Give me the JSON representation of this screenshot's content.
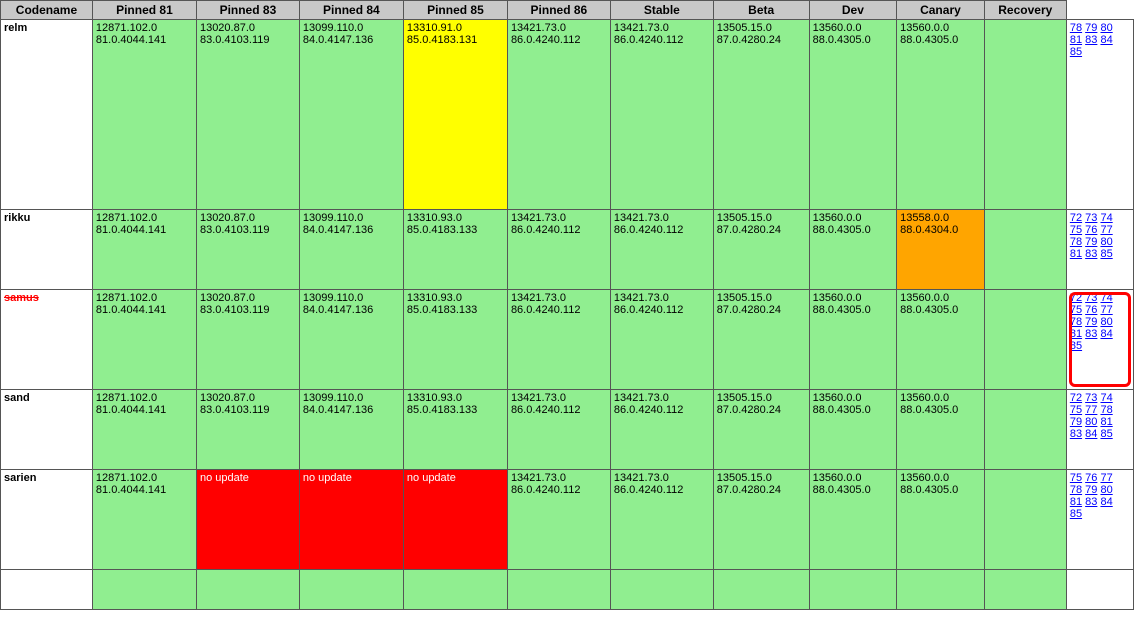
{
  "headers": [
    "Codename",
    "Pinned 81",
    "Pinned 83",
    "Pinned 84",
    "Pinned 85",
    "Pinned 86",
    "Stable",
    "Beta",
    "Dev",
    "Canary",
    "Recovery"
  ],
  "rows": [
    {
      "name": "relm",
      "nameClass": "",
      "cells": [
        {
          "text": "12871.102.0\n81.0.4044.141",
          "class": "cell-green"
        },
        {
          "text": "13020.87.0\n83.0.4103.119",
          "class": "cell-green"
        },
        {
          "text": "13099.110.0\n84.0.4147.136",
          "class": "cell-green"
        },
        {
          "text": "13310.91.0\n85.0.4183.131",
          "class": "cell-yellow"
        },
        {
          "text": "13421.73.0\n86.0.4240.112",
          "class": "cell-green"
        },
        {
          "text": "13421.73.0\n86.0.4240.112",
          "class": "cell-green"
        },
        {
          "text": "13505.15.0\n87.0.4280.24",
          "class": "cell-green"
        },
        {
          "text": "13560.0.0\n88.0.4305.0",
          "class": "cell-green"
        },
        {
          "text": "13560.0.0\n88.0.4305.0",
          "class": "cell-green"
        },
        {
          "text": "",
          "class": "cell-green"
        }
      ],
      "recovery": [
        "78",
        "79",
        "80",
        "81",
        "83",
        "84",
        "85"
      ],
      "recoveryExtraRows": true
    },
    {
      "name": "rikku",
      "nameClass": "",
      "cells": [
        {
          "text": "12871.102.0\n81.0.4044.141",
          "class": "cell-green"
        },
        {
          "text": "13020.87.0\n83.0.4103.119",
          "class": "cell-green"
        },
        {
          "text": "13099.110.0\n84.0.4147.136",
          "class": "cell-green"
        },
        {
          "text": "13310.93.0\n85.0.4183.133",
          "class": "cell-green"
        },
        {
          "text": "13421.73.0\n86.0.4240.112",
          "class": "cell-green"
        },
        {
          "text": "13421.73.0\n86.0.4240.112",
          "class": "cell-green"
        },
        {
          "text": "13505.15.0\n87.0.4280.24",
          "class": "cell-green"
        },
        {
          "text": "13560.0.0\n88.0.4305.0",
          "class": "cell-green"
        },
        {
          "text": "13558.0.0\n88.0.4304.0",
          "class": "cell-orange"
        },
        {
          "text": "",
          "class": "cell-green"
        }
      ],
      "recovery": [
        "72",
        "73",
        "74",
        "75",
        "76",
        "77",
        "78",
        "79",
        "80",
        "81",
        "83",
        "85"
      ],
      "recoveryRows": [
        [
          "72",
          "73",
          "74"
        ],
        [
          "75",
          "76",
          "77"
        ],
        [
          "78",
          "79",
          "80"
        ],
        [
          "81",
          "83",
          "85"
        ]
      ]
    },
    {
      "name": "samus",
      "nameClass": "codename-samus",
      "cells": [
        {
          "text": "12871.102.0\n81.0.4044.141",
          "class": "cell-green"
        },
        {
          "text": "13020.87.0\n83.0.4103.119",
          "class": "cell-green"
        },
        {
          "text": "13099.110.0\n84.0.4147.136",
          "class": "cell-green"
        },
        {
          "text": "13310.93.0\n85.0.4183.133",
          "class": "cell-green"
        },
        {
          "text": "13421.73.0\n86.0.4240.112",
          "class": "cell-green"
        },
        {
          "text": "13421.73.0\n86.0.4240.112",
          "class": "cell-green"
        },
        {
          "text": "13505.15.0\n87.0.4280.24",
          "class": "cell-green"
        },
        {
          "text": "13560.0.0\n88.0.4305.0",
          "class": "cell-green"
        },
        {
          "text": "13560.0.0\n88.0.4305.0",
          "class": "cell-green"
        },
        {
          "text": "",
          "class": "cell-green"
        }
      ],
      "recovery": [
        "72",
        "73",
        "74",
        "75",
        "76",
        "77",
        "78",
        "79",
        "80",
        "81",
        "83",
        "84",
        "85"
      ],
      "recoveryRows": [
        [
          "72",
          "73",
          "74"
        ],
        [
          "75",
          "76",
          "77"
        ],
        [
          "78",
          "79",
          "80"
        ],
        [
          "81",
          "83",
          "84"
        ],
        [
          "85"
        ]
      ],
      "redCircle": true
    },
    {
      "name": "sand",
      "nameClass": "",
      "cells": [
        {
          "text": "12871.102.0\n81.0.4044.141",
          "class": "cell-green"
        },
        {
          "text": "13020.87.0\n83.0.4103.119",
          "class": "cell-green"
        },
        {
          "text": "13099.110.0\n84.0.4147.136",
          "class": "cell-green"
        },
        {
          "text": "13310.93.0\n85.0.4183.133",
          "class": "cell-green"
        },
        {
          "text": "13421.73.0\n86.0.4240.112",
          "class": "cell-green"
        },
        {
          "text": "13421.73.0\n86.0.4240.112",
          "class": "cell-green"
        },
        {
          "text": "13505.15.0\n87.0.4280.24",
          "class": "cell-green"
        },
        {
          "text": "13560.0.0\n88.0.4305.0",
          "class": "cell-green"
        },
        {
          "text": "13560.0.0\n88.0.4305.0",
          "class": "cell-green"
        },
        {
          "text": "",
          "class": "cell-green"
        }
      ],
      "recovery": [
        "72",
        "73",
        "74",
        "75",
        "77",
        "78",
        "79",
        "80",
        "81",
        "83",
        "84",
        "85"
      ],
      "recoveryRows": [
        [
          "72",
          "73",
          "74"
        ],
        [
          "75",
          "77",
          "78"
        ],
        [
          "79",
          "80",
          "81"
        ],
        [
          "83",
          "84",
          "85"
        ]
      ]
    },
    {
      "name": "sarien",
      "nameClass": "",
      "cells": [
        {
          "text": "12871.102.0\n81.0.4044.141",
          "class": "cell-green"
        },
        {
          "text": "no update",
          "class": "cell-red"
        },
        {
          "text": "no update",
          "class": "cell-red"
        },
        {
          "text": "no update",
          "class": "cell-red"
        },
        {
          "text": "13421.73.0\n86.0.4240.112",
          "class": "cell-green"
        },
        {
          "text": "13421.73.0\n86.0.4240.112",
          "class": "cell-green"
        },
        {
          "text": "13505.15.0\n87.0.4280.24",
          "class": "cell-green"
        },
        {
          "text": "13560.0.0\n88.0.4305.0",
          "class": "cell-green"
        },
        {
          "text": "13560.0.0\n88.0.4305.0",
          "class": "cell-green"
        },
        {
          "text": "",
          "class": "cell-green"
        }
      ],
      "recovery": [
        "75",
        "76",
        "77",
        "78",
        "79",
        "80",
        "81",
        "83",
        "84",
        "85"
      ],
      "recoveryRows": [
        [
          "75",
          "76",
          "77"
        ],
        [
          "78",
          "79",
          "80"
        ],
        [
          "81",
          "83",
          "84"
        ],
        [
          "85"
        ]
      ]
    },
    {
      "name": "",
      "nameClass": "",
      "cells": [
        {
          "text": "",
          "class": "cell-green"
        },
        {
          "text": "",
          "class": "cell-green"
        },
        {
          "text": "",
          "class": "cell-green"
        },
        {
          "text": "",
          "class": "cell-green"
        },
        {
          "text": "",
          "class": "cell-green"
        },
        {
          "text": "",
          "class": "cell-green"
        },
        {
          "text": "",
          "class": "cell-green"
        },
        {
          "text": "",
          "class": "cell-green"
        },
        {
          "text": "",
          "class": "cell-green"
        },
        {
          "text": "",
          "class": "cell-green"
        }
      ],
      "recovery": [],
      "recoveryRows": []
    }
  ]
}
